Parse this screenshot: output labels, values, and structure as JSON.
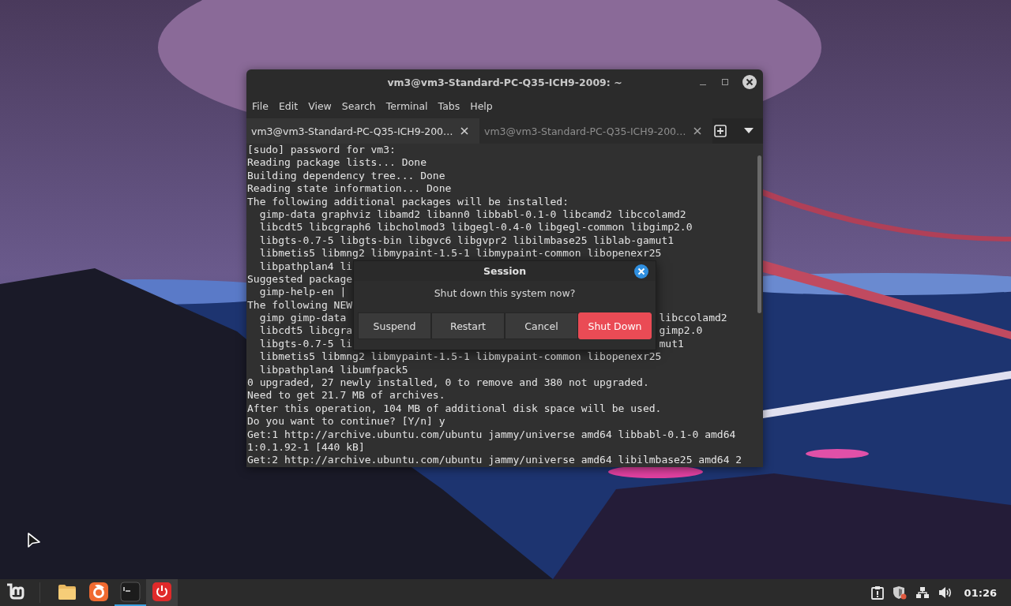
{
  "terminal_window": {
    "title": "vm3@vm3-Standard-PC-Q35-ICH9-2009: ~",
    "menu": [
      "File",
      "Edit",
      "View",
      "Search",
      "Terminal",
      "Tabs",
      "Help"
    ],
    "tabs": [
      {
        "label": "vm3@vm3-Standard-PC-Q35-ICH9-200…",
        "selected": true
      },
      {
        "label": "vm3@vm3-Standard-PC-Q35-ICH9-200…",
        "selected": false
      }
    ],
    "lines": [
      {
        "text": "[sudo] password for vm3:"
      },
      {
        "text": "Reading package lists... Done"
      },
      {
        "text": "Building dependency tree... Done"
      },
      {
        "text": "Reading state information... Done"
      },
      {
        "text": "The following additional packages will be installed:"
      },
      {
        "text": "  gimp-data graphviz libamd2 libann0 libbabl-0.1-0 libcamd2 libccolamd2"
      },
      {
        "text": "  libcdt5 libcgraph6 libcholmod3 libgegl-0.4-0 libgegl-common libgimp2.0"
      },
      {
        "text": "  libgts-0.7-5 libgts-bin libgvc6 libgvpr2 libilmbase25 liblab-gamut1"
      },
      {
        "text": "  libmetis5 libmng2 libmypaint-1.5-1 libmypaint-common libopenexr25"
      },
      {
        "text": "  libpathplan4 li"
      },
      {
        "text": "Suggested package"
      },
      {
        "text": "  gimp-help-en |"
      },
      {
        "text": "The following NEW"
      },
      {
        "text": "  gimp gimp-data",
        "tail": "libccolamd2"
      },
      {
        "text": "  libcdt5 libcgra",
        "tail": "gimp2.0"
      },
      {
        "text": "  libgts-0.7-5 li",
        "tail": "mut1"
      },
      {
        "text": "  libmetis5 libmng2 libmypaint-1.5-1 libmypaint-common libopenexr25"
      },
      {
        "text": "  libpathplan4 libumfpack5"
      },
      {
        "text": "0 upgraded, 27 newly installed, 0 to remove and 380 not upgraded."
      },
      {
        "text": "Need to get 21.7 MB of archives."
      },
      {
        "text": "After this operation, 104 MB of additional disk space will be used."
      },
      {
        "text": "Do you want to continue? [Y/n] y"
      },
      {
        "text": "Get:1 http://archive.ubuntu.com/ubuntu jammy/universe amd64 libbabl-0.1-0 amd64"
      },
      {
        "text": "1:0.1.92-1 [440 kB]"
      },
      {
        "text": "Get:2 http://archive.ubuntu.com/ubuntu jammy/universe amd64 libilmbase25 amd64 2"
      }
    ]
  },
  "dialog": {
    "title": "Session",
    "message": "Shut down this system now?",
    "buttons": [
      {
        "label": "Suspend",
        "kind": "normal"
      },
      {
        "label": "Restart",
        "kind": "normal"
      },
      {
        "label": "Cancel",
        "kind": "normal"
      },
      {
        "label": "Shut Down",
        "kind": "destructive"
      }
    ]
  },
  "taskbar": {
    "launchers": [
      {
        "kind": "files",
        "running": false,
        "hovered": false
      },
      {
        "kind": "browser",
        "running": false,
        "hovered": false
      },
      {
        "kind": "terminal",
        "running": true,
        "hovered": false
      },
      {
        "kind": "power",
        "running": false,
        "hovered": true
      }
    ],
    "clock": "01:26"
  }
}
